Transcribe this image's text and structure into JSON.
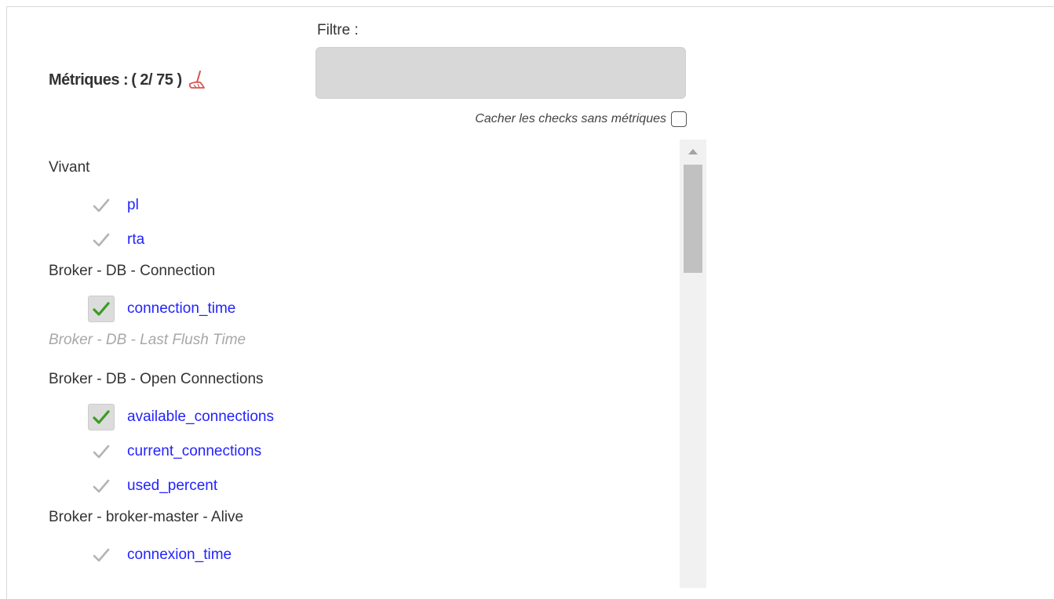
{
  "filter": {
    "label": "Filtre :",
    "value": "",
    "placeholder": ""
  },
  "metrics_header": {
    "title": "Métriques :",
    "count": "( 2/ 75 )",
    "clear_icon": "broom-icon"
  },
  "hide_checks": {
    "label": "Cacher les checks sans métriques",
    "checked": false
  },
  "groups": [
    {
      "name": "Vivant",
      "disabled": false,
      "metrics": [
        {
          "label": "pl",
          "checked": false
        },
        {
          "label": "rta",
          "checked": false
        }
      ]
    },
    {
      "name": "Broker - DB - Connection",
      "disabled": false,
      "metrics": [
        {
          "label": "connection_time",
          "checked": true
        }
      ]
    },
    {
      "name": "Broker - DB - Last Flush Time",
      "disabled": true,
      "metrics": []
    },
    {
      "name": "Broker - DB - Open Connections",
      "disabled": false,
      "metrics": [
        {
          "label": "available_connections",
          "checked": true
        },
        {
          "label": "current_connections",
          "checked": false
        },
        {
          "label": "used_percent",
          "checked": false
        }
      ]
    },
    {
      "name": "Broker - broker-master - Alive",
      "disabled": false,
      "metrics": [
        {
          "label": "connexion_time",
          "checked": false
        }
      ]
    }
  ],
  "colors": {
    "metric_link": "#2323ff",
    "check_on": "#3a9d23",
    "check_off": "#b3b3b3",
    "disabled_group": "#a8a8a8",
    "broom": "#d9534f"
  }
}
